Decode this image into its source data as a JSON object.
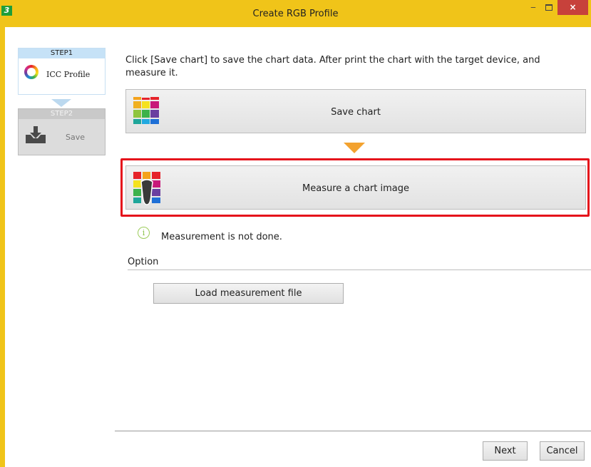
{
  "window": {
    "app_icon_letter": "3",
    "title": "Create RGB Profile",
    "minimize_glyph": "‒",
    "close_glyph": "×"
  },
  "steps": [
    {
      "header": "STEP1",
      "label": "ICC Profile",
      "icon": "color-wheel-icon",
      "state": "active"
    },
    {
      "header": "STEP2",
      "label": "Save",
      "icon": "save-tray-icon",
      "state": "disabled"
    }
  ],
  "main": {
    "instruction": "Click [Save chart] to save the chart data. After print the chart with the target device, and measure it.",
    "save_chart_label": "Save chart",
    "measure_label": "Measure a chart image",
    "status_icon": "i",
    "status_text": "Measurement is not done.",
    "option_label": "Option",
    "load_file_label": "Load measurement file"
  },
  "footer": {
    "next_label": "Next",
    "cancel_label": "Cancel"
  },
  "colors": {
    "title_bar": "#f0c419",
    "highlight_border": "#e5121b",
    "flow_arrow": "#f3a22f",
    "close_button": "#c7413b"
  }
}
